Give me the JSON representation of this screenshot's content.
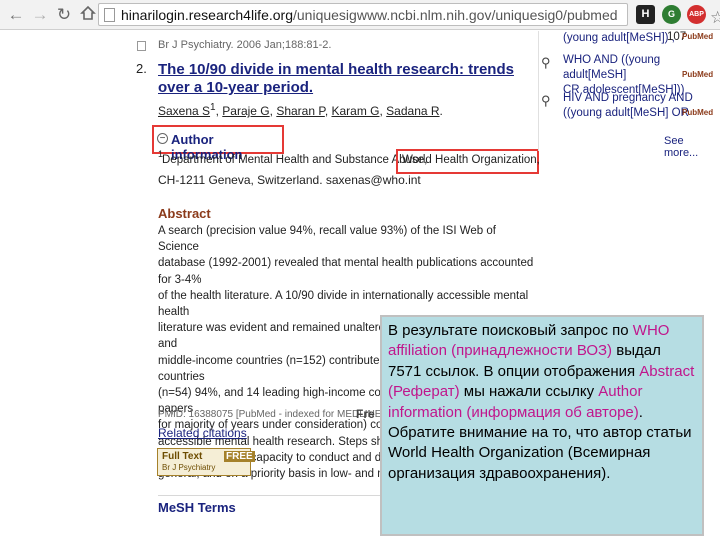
{
  "browser": {
    "url_host": "hinarilogin.research4life.org",
    "url_path": "/uniquesigwww.ncbi.nlm.nih.gov/uniquesig0/pubmed",
    "ext_h": "H",
    "ext_g": "G",
    "ext_abp": "ABP"
  },
  "article": {
    "citation_top": "Br J Psychiatry. 2006 Jan;188:81-2.",
    "number": "2.",
    "title": "The 10/90 divide in mental health research: trends over a 10-year period.",
    "authors": [
      {
        "name": "Saxena S",
        "sup": "1"
      },
      {
        "name": "Paraje G",
        "sup": ""
      },
      {
        "name": "Sharan P",
        "sup": ""
      },
      {
        "name": "Karam G",
        "sup": ""
      },
      {
        "name": "Sadana R",
        "sup": ""
      }
    ],
    "author_info_label": "Author information",
    "affil_sup": "1",
    "affil_part1": "Department of Mental Health and Substance Abuse,",
    "affil_who": "World Health Organization,",
    "affil_part2": "CH-1211 Geneva, Switzerland. saxenas@who.int",
    "abstract_heading": "Abstract",
    "abstract_lines": [
      "A search (precision value 94%, recall value 93%) of the ISI Web of Science",
      "database (1992-2001) revealed that mental health publications accounted for 3-4%",
      "of the health literature. A 10/90 divide in internationally accessible mental health",
      "literature was evident and remained unaltered through 10 years as low- and",
      "middle-income countries (n=152) contributed only 6%, high-income countries",
      "(n=54) 94%, and 14 leading high-income countries contributed 90% of papers",
      "for majority of years under consideration) contrib",
      "accessible mental health research. Steps should",
      "infrastructure and capacity to conduct and disse",
      "general, and on a priority basis in low- and middle"
    ],
    "pmid": "PMID: 16388075 [PubMed - indexed for MEDLINE]",
    "free_note": "Fre",
    "related": "Related citations",
    "fulltext": {
      "label": "Full Text",
      "journal": "Br J Psychiatry",
      "free": "FREE"
    },
    "mesh": "MeSH Terms"
  },
  "side": {
    "items": [
      {
        "query_lines": [
          "(young adult[MeSH]) ,"
        ],
        "count": "107",
        "badge": "PubMed"
      },
      {
        "query_lines": [
          "WHO AND ((young adult[MeSH]",
          "CR adolescent[MeSH]))"
        ],
        "count": "",
        "badge": "PubMed"
      },
      {
        "query_lines": [
          "HIV AND pregnancy AND",
          "((young adult[MeSH] OR"
        ],
        "count": "",
        "badge": "PubMed"
      }
    ],
    "see_more": "See more..."
  },
  "callout": {
    "p1": "В результате поисковый запрос по ",
    "hl1": "WHO affiliation (принадлежности ВОЗ)",
    "p2": " выдал 7571 ссылок. В опции отображения ",
    "hl2": "Abstract (Реферат)",
    "p3": " мы нажали ссылку ",
    "hl3": "Author information (информация об авторе)",
    "p4": ". Обратите внимание на то, что автор статьи World Health Organization (Всемирная организация здравоохранения)."
  }
}
